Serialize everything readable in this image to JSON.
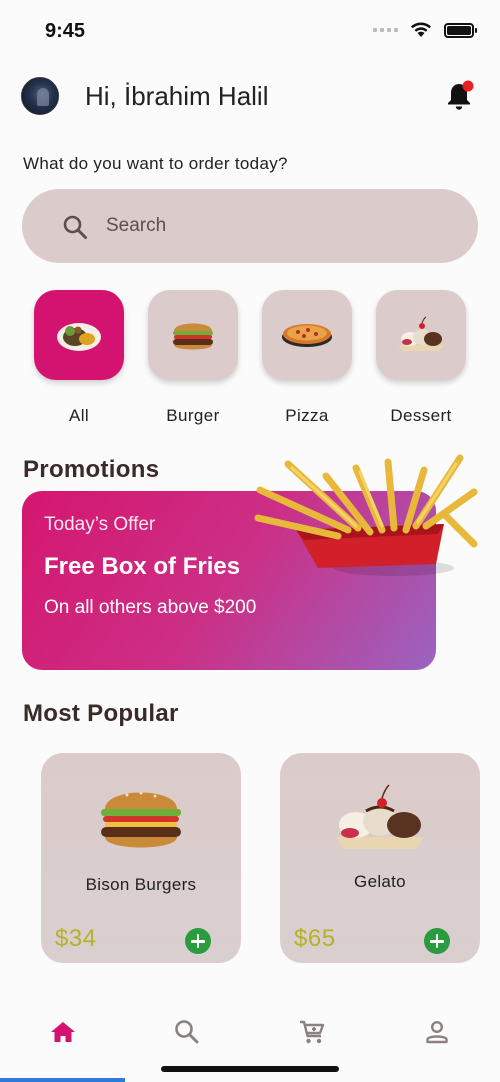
{
  "status": {
    "time": "9:45"
  },
  "header": {
    "greeting": "Hi, İbrahim Halil"
  },
  "subtitle": "What do you want to order today?",
  "search": {
    "placeholder": "Search"
  },
  "categories": [
    {
      "label": "All",
      "icon": "plate-icon",
      "active": true
    },
    {
      "label": "Burger",
      "icon": "burger-icon",
      "active": false
    },
    {
      "label": "Pizza",
      "icon": "pizza-icon",
      "active": false
    },
    {
      "label": "Dessert",
      "icon": "dessert-icon",
      "active": false
    }
  ],
  "promotions": {
    "title": "Promotions",
    "kicker": "Today’s Offer",
    "headline": "Free Box of Fries",
    "description": "On all others above $200"
  },
  "popular": {
    "title": "Most Popular",
    "items": [
      {
        "name": "Bison Burgers",
        "price": "$34"
      },
      {
        "name": "Gelato",
        "price": "$65"
      }
    ]
  },
  "nav": [
    {
      "icon": "home-icon",
      "active": true
    },
    {
      "icon": "search-icon",
      "active": false
    },
    {
      "icon": "cart-icon",
      "active": false
    },
    {
      "icon": "profile-icon",
      "active": false
    }
  ],
  "colors": {
    "accent": "#d3136f",
    "tile": "#dccbcb",
    "price": "#b5b228",
    "add": "#2b9b3f",
    "notification_dot": "#e52222"
  }
}
